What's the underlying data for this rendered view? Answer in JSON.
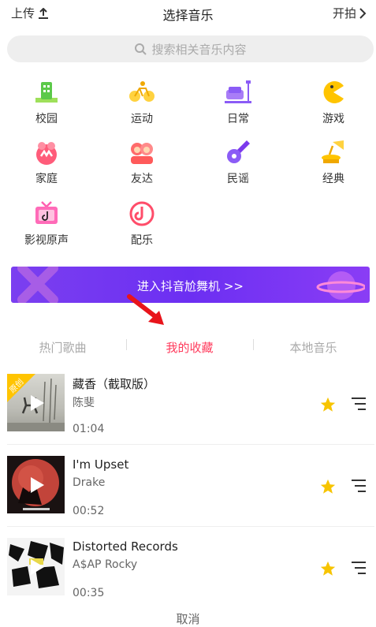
{
  "header": {
    "upload_label": "上传",
    "title": "选择音乐",
    "shoot_label": "开拍"
  },
  "search": {
    "placeholder": "搜索相关音乐内容"
  },
  "categories": [
    {
      "label": "校园",
      "icon": "school-icon"
    },
    {
      "label": "运动",
      "icon": "bicycle-icon"
    },
    {
      "label": "日常",
      "icon": "sofa-icon"
    },
    {
      "label": "游戏",
      "icon": "pacman-icon"
    },
    {
      "label": "家庭",
      "icon": "family-icon"
    },
    {
      "label": "友达",
      "icon": "friends-icon"
    },
    {
      "label": "民谣",
      "icon": "guitar-icon"
    },
    {
      "label": "经典",
      "icon": "gramophone-icon"
    },
    {
      "label": "影视原声",
      "icon": "tv-icon"
    },
    {
      "label": "配乐",
      "icon": "music-disc-icon"
    }
  ],
  "banner": {
    "label": "进入抖音尬舞机 >>"
  },
  "tabs": [
    {
      "label": "热门歌曲",
      "active": false
    },
    {
      "label": "我的收藏",
      "active": true
    },
    {
      "label": "本地音乐",
      "active": false
    }
  ],
  "songs": [
    {
      "title": "藏香（截取版）",
      "artist": "陈斐",
      "duration": "01:04",
      "badge": "原创",
      "favorited": true
    },
    {
      "title": "I'm Upset",
      "artist": "Drake",
      "duration": "00:52",
      "favorited": true
    },
    {
      "title": "Distorted Records",
      "artist": "A$AP Rocky",
      "duration": "00:35",
      "favorited": true
    }
  ],
  "cancel_label": "取消",
  "colors": {
    "accent": "#ff3b5c",
    "star": "#f7c400",
    "banner": "#7b3ff0"
  }
}
